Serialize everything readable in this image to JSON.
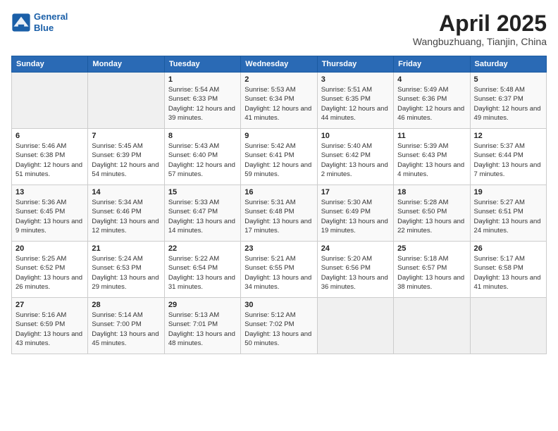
{
  "logo": {
    "line1": "General",
    "line2": "Blue"
  },
  "title": "April 2025",
  "location": "Wangbuzhuang, Tianjin, China",
  "headers": [
    "Sunday",
    "Monday",
    "Tuesday",
    "Wednesday",
    "Thursday",
    "Friday",
    "Saturday"
  ],
  "rows": [
    [
      {
        "day": "",
        "info": ""
      },
      {
        "day": "",
        "info": ""
      },
      {
        "day": "1",
        "info": "Sunrise: 5:54 AM\nSunset: 6:33 PM\nDaylight: 12 hours and 39 minutes."
      },
      {
        "day": "2",
        "info": "Sunrise: 5:53 AM\nSunset: 6:34 PM\nDaylight: 12 hours and 41 minutes."
      },
      {
        "day": "3",
        "info": "Sunrise: 5:51 AM\nSunset: 6:35 PM\nDaylight: 12 hours and 44 minutes."
      },
      {
        "day": "4",
        "info": "Sunrise: 5:49 AM\nSunset: 6:36 PM\nDaylight: 12 hours and 46 minutes."
      },
      {
        "day": "5",
        "info": "Sunrise: 5:48 AM\nSunset: 6:37 PM\nDaylight: 12 hours and 49 minutes."
      }
    ],
    [
      {
        "day": "6",
        "info": "Sunrise: 5:46 AM\nSunset: 6:38 PM\nDaylight: 12 hours and 51 minutes."
      },
      {
        "day": "7",
        "info": "Sunrise: 5:45 AM\nSunset: 6:39 PM\nDaylight: 12 hours and 54 minutes."
      },
      {
        "day": "8",
        "info": "Sunrise: 5:43 AM\nSunset: 6:40 PM\nDaylight: 12 hours and 57 minutes."
      },
      {
        "day": "9",
        "info": "Sunrise: 5:42 AM\nSunset: 6:41 PM\nDaylight: 12 hours and 59 minutes."
      },
      {
        "day": "10",
        "info": "Sunrise: 5:40 AM\nSunset: 6:42 PM\nDaylight: 13 hours and 2 minutes."
      },
      {
        "day": "11",
        "info": "Sunrise: 5:39 AM\nSunset: 6:43 PM\nDaylight: 13 hours and 4 minutes."
      },
      {
        "day": "12",
        "info": "Sunrise: 5:37 AM\nSunset: 6:44 PM\nDaylight: 13 hours and 7 minutes."
      }
    ],
    [
      {
        "day": "13",
        "info": "Sunrise: 5:36 AM\nSunset: 6:45 PM\nDaylight: 13 hours and 9 minutes."
      },
      {
        "day": "14",
        "info": "Sunrise: 5:34 AM\nSunset: 6:46 PM\nDaylight: 13 hours and 12 minutes."
      },
      {
        "day": "15",
        "info": "Sunrise: 5:33 AM\nSunset: 6:47 PM\nDaylight: 13 hours and 14 minutes."
      },
      {
        "day": "16",
        "info": "Sunrise: 5:31 AM\nSunset: 6:48 PM\nDaylight: 13 hours and 17 minutes."
      },
      {
        "day": "17",
        "info": "Sunrise: 5:30 AM\nSunset: 6:49 PM\nDaylight: 13 hours and 19 minutes."
      },
      {
        "day": "18",
        "info": "Sunrise: 5:28 AM\nSunset: 6:50 PM\nDaylight: 13 hours and 22 minutes."
      },
      {
        "day": "19",
        "info": "Sunrise: 5:27 AM\nSunset: 6:51 PM\nDaylight: 13 hours and 24 minutes."
      }
    ],
    [
      {
        "day": "20",
        "info": "Sunrise: 5:25 AM\nSunset: 6:52 PM\nDaylight: 13 hours and 26 minutes."
      },
      {
        "day": "21",
        "info": "Sunrise: 5:24 AM\nSunset: 6:53 PM\nDaylight: 13 hours and 29 minutes."
      },
      {
        "day": "22",
        "info": "Sunrise: 5:22 AM\nSunset: 6:54 PM\nDaylight: 13 hours and 31 minutes."
      },
      {
        "day": "23",
        "info": "Sunrise: 5:21 AM\nSunset: 6:55 PM\nDaylight: 13 hours and 34 minutes."
      },
      {
        "day": "24",
        "info": "Sunrise: 5:20 AM\nSunset: 6:56 PM\nDaylight: 13 hours and 36 minutes."
      },
      {
        "day": "25",
        "info": "Sunrise: 5:18 AM\nSunset: 6:57 PM\nDaylight: 13 hours and 38 minutes."
      },
      {
        "day": "26",
        "info": "Sunrise: 5:17 AM\nSunset: 6:58 PM\nDaylight: 13 hours and 41 minutes."
      }
    ],
    [
      {
        "day": "27",
        "info": "Sunrise: 5:16 AM\nSunset: 6:59 PM\nDaylight: 13 hours and 43 minutes."
      },
      {
        "day": "28",
        "info": "Sunrise: 5:14 AM\nSunset: 7:00 PM\nDaylight: 13 hours and 45 minutes."
      },
      {
        "day": "29",
        "info": "Sunrise: 5:13 AM\nSunset: 7:01 PM\nDaylight: 13 hours and 48 minutes."
      },
      {
        "day": "30",
        "info": "Sunrise: 5:12 AM\nSunset: 7:02 PM\nDaylight: 13 hours and 50 minutes."
      },
      {
        "day": "",
        "info": ""
      },
      {
        "day": "",
        "info": ""
      },
      {
        "day": "",
        "info": ""
      }
    ]
  ]
}
